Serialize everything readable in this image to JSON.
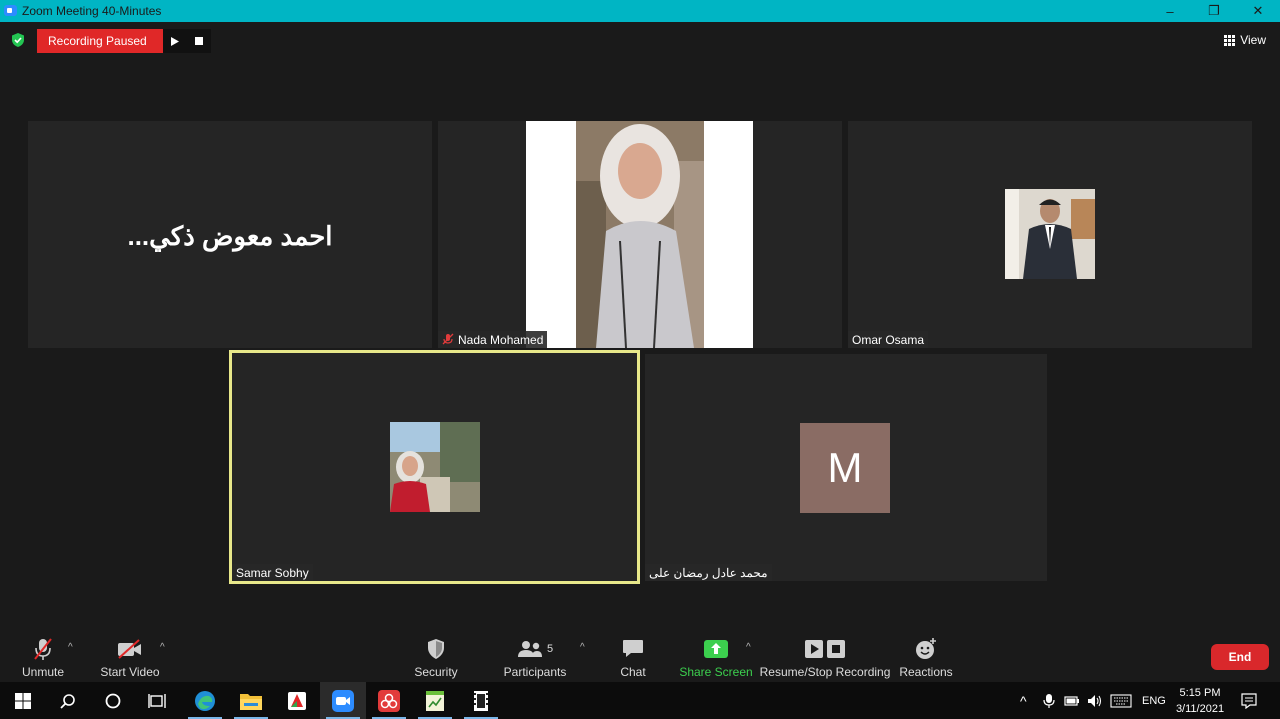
{
  "window": {
    "title": "Zoom Meeting 40-Minutes",
    "minimize": "–",
    "maximize": "❐",
    "close": "✕"
  },
  "topbar": {
    "recording_status": "Recording Paused",
    "view_label": "View"
  },
  "participants": {
    "ahmed": {
      "name": "احمد معوض ذكي..."
    },
    "nada": {
      "name": "Nada Mohamed"
    },
    "omar": {
      "name": "Omar Osama"
    },
    "samar": {
      "name": "Samar Sobhy"
    },
    "mohamed": {
      "name": "محمد عادل رمضان على",
      "avatar_letter": "M"
    }
  },
  "toolbar": {
    "unmute": "Unmute",
    "start_video": "Start Video",
    "security": "Security",
    "participants": "Participants",
    "participants_count": "5",
    "chat": "Chat",
    "share_screen": "Share Screen",
    "recording": "Resume/Stop Recording",
    "reactions": "Reactions",
    "end": "End"
  },
  "taskbar": {
    "language": "ENG",
    "time": "5:15 PM",
    "date": "3/11/2021"
  },
  "colors": {
    "titlebar": "#00b5c4",
    "recording": "#e02828",
    "active_speaker_border": "#e8e88a",
    "share_green": "#3ccf4e",
    "end_red": "#d9282b"
  }
}
